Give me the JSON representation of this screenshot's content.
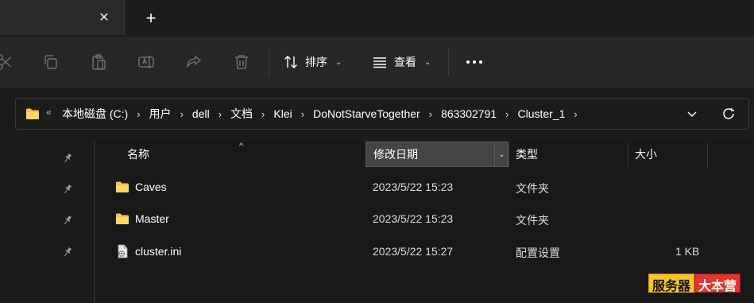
{
  "tabs": {
    "close_glyph": "✕",
    "new_tab_glyph": "+"
  },
  "toolbar": {
    "sort_label": "排序",
    "view_label": "查看",
    "icons": [
      "cut-icon",
      "copy-icon",
      "paste-icon",
      "rename-icon",
      "share-icon",
      "delete-icon",
      "sort-icon",
      "view-icon",
      "more-icon"
    ]
  },
  "address": {
    "overflow_glyph": "«",
    "crumbs": [
      "本地磁盘 (C:)",
      "用户",
      "dell",
      "文档",
      "Klei",
      "DoNotStarveTogether",
      "863302791",
      "Cluster_1"
    ],
    "separator": "›"
  },
  "columns": {
    "name": "名称",
    "date": "修改日期",
    "type": "类型",
    "size": "大小"
  },
  "files": [
    {
      "name": "Caves",
      "date": "2023/5/22 15:23",
      "type": "文件夹",
      "size": "",
      "icon": "folder-icon"
    },
    {
      "name": "Master",
      "date": "2023/5/22 15:23",
      "type": "文件夹",
      "size": "",
      "icon": "folder-icon"
    },
    {
      "name": "cluster.ini",
      "date": "2023/5/22 15:27",
      "type": "配置设置",
      "size": "1 KB",
      "icon": "settings-file-icon"
    }
  ],
  "watermark": {
    "part1": "服务器",
    "part2": "大本营"
  },
  "colors": {
    "folder": "#f5c543",
    "background": "#191919",
    "active_column": "#454545"
  }
}
